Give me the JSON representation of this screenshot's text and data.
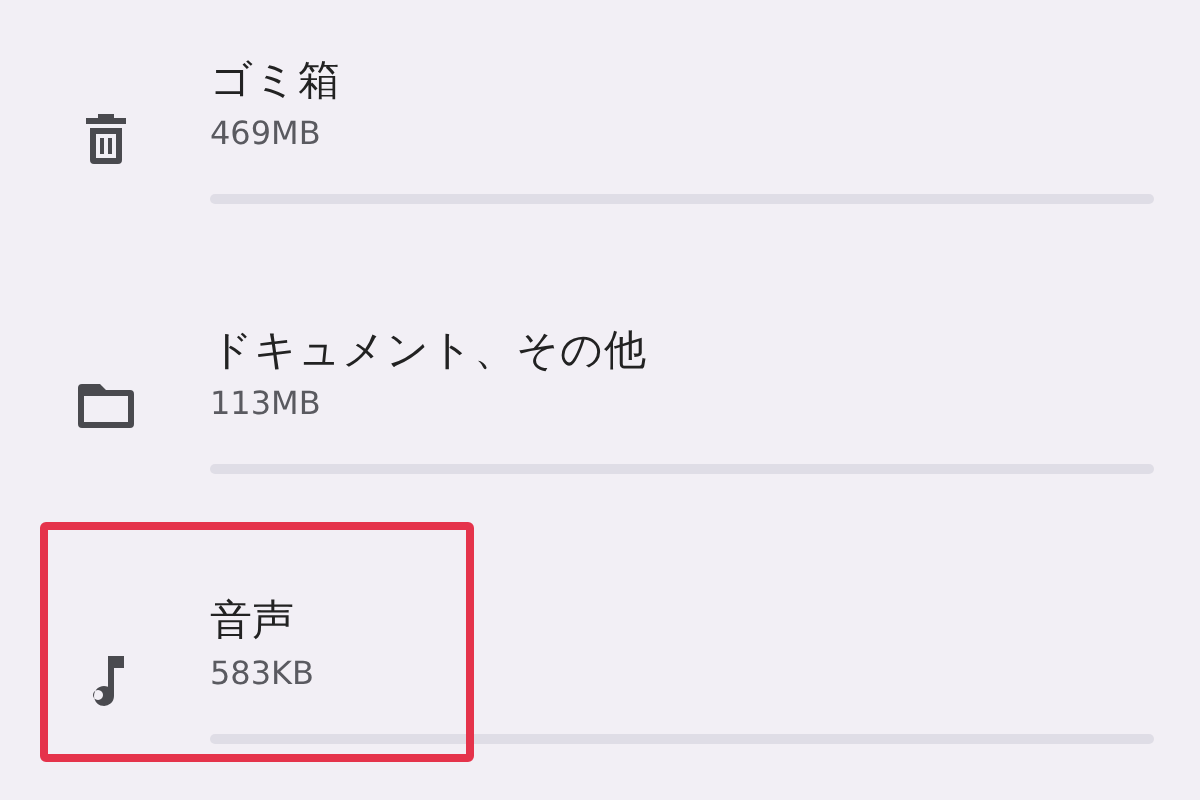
{
  "storage_items": [
    {
      "kind": "trash",
      "title": "ゴミ箱",
      "size": "469MB",
      "level": 0,
      "highlighted": false
    },
    {
      "kind": "folder",
      "title": "ドキュメント、その他",
      "size": "113MB",
      "level": 0,
      "highlighted": false
    },
    {
      "kind": "music",
      "title": "音声",
      "size": "583KB",
      "level": 0,
      "highlighted": true
    }
  ]
}
